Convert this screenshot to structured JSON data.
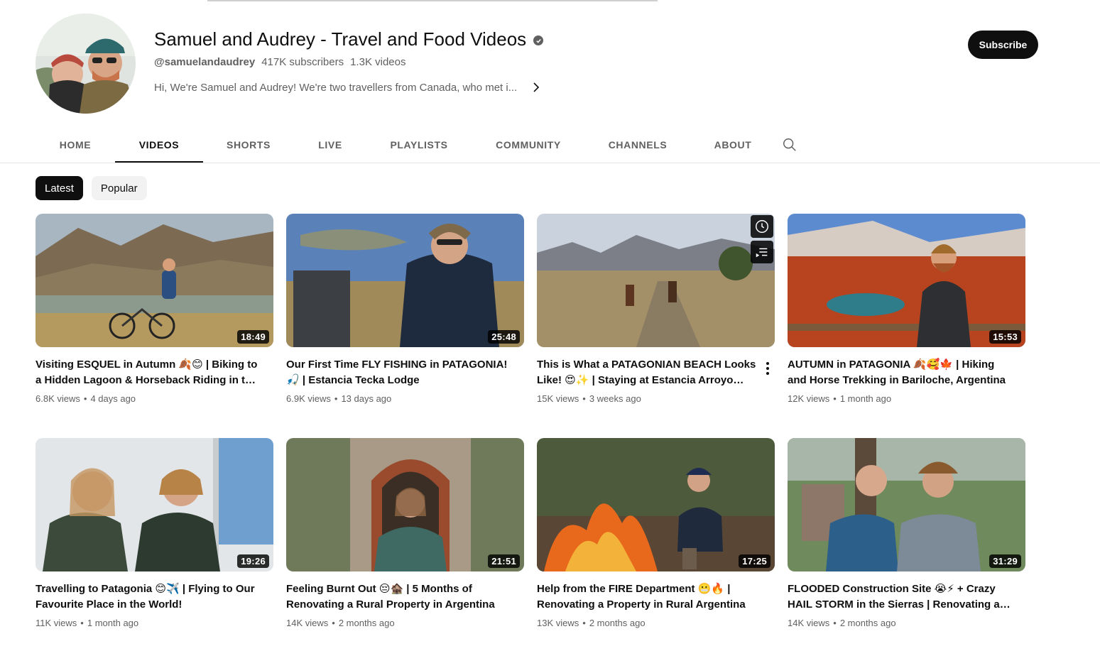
{
  "channel": {
    "name": "Samuel and Audrey - Travel and Food Videos",
    "handle": "@samuelandaudrey",
    "subscribers": "417K subscribers",
    "video_count": "1.3K videos",
    "description": "Hi, We're Samuel and Audrey! We're two travellers from Canada, who met i...",
    "subscribe_label": "Subscribe",
    "verified_icon": "verified-check-icon"
  },
  "tabs": [
    {
      "label": "HOME"
    },
    {
      "label": "VIDEOS",
      "active": true
    },
    {
      "label": "SHORTS"
    },
    {
      "label": "LIVE"
    },
    {
      "label": "PLAYLISTS"
    },
    {
      "label": "COMMUNITY"
    },
    {
      "label": "CHANNELS"
    },
    {
      "label": "ABOUT"
    }
  ],
  "chips": [
    {
      "label": "Latest",
      "active": true
    },
    {
      "label": "Popular"
    }
  ],
  "videos": [
    {
      "title": "Visiting ESQUEL in Autumn 🍂😊 | Biking to a Hidden Lagoon & Horseback Riding in the Andes",
      "views": "6.8K views",
      "age": "4 days ago",
      "duration": "18:49"
    },
    {
      "title": "Our First Time FLY FISHING in PATAGONIA! 🎣 | Estancia Tecka Lodge",
      "views": "6.9K views",
      "age": "13 days ago",
      "duration": "25:48"
    },
    {
      "title": "This is What a PATAGONIAN BEACH Looks Like! 😍✨ | Staying at Estancia Arroyo Verde",
      "views": "15K views",
      "age": "3 weeks ago",
      "duration": ""
    },
    {
      "title": "AUTUMN in PATAGONIA 🍂🥰🍁 | Hiking and Horse Trekking in Bariloche, Argentina",
      "views": "12K views",
      "age": "1 month ago",
      "duration": "15:53"
    },
    {
      "title": "Travelling to Patagonia 😊✈️ | Flying to Our Favourite Place in the World!",
      "views": "11K views",
      "age": "1 month ago",
      "duration": "19:26"
    },
    {
      "title": "Feeling Burnt Out 😔🏚️ | 5 Months of Renovating a Rural Property in Argentina",
      "views": "14K views",
      "age": "2 months ago",
      "duration": "21:51"
    },
    {
      "title": "Help from the FIRE Department 😬🔥 | Renovating a Property in Rural Argentina",
      "views": "13K views",
      "age": "2 months ago",
      "duration": "17:25"
    },
    {
      "title": "FLOODED Construction Site 😭⚡ + Crazy HAIL STORM in the Sierras | Renovating a Rural Property",
      "views": "14K views",
      "age": "2 months ago",
      "duration": "31:29"
    }
  ]
}
